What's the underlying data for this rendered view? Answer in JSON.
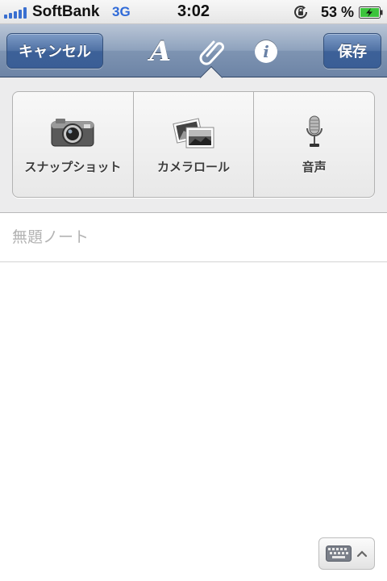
{
  "status_bar": {
    "carrier": "SoftBank",
    "network": "3G",
    "time": "3:02",
    "battery_percent": "53 %",
    "icons": [
      "signal-bars-icon",
      "rotation-lock-icon",
      "battery-charging-icon"
    ]
  },
  "nav": {
    "cancel_label": "キャンセル",
    "save_label": "保存",
    "format_icon_glyph": "A",
    "info_icon_glyph": "i",
    "icons": [
      "text-format-icon",
      "paperclip-icon",
      "info-icon"
    ]
  },
  "attach": {
    "items": [
      {
        "label": "スナップショット",
        "icon": "camera-icon"
      },
      {
        "label": "カメラロール",
        "icon": "photos-icon"
      },
      {
        "label": "音声",
        "icon": "microphone-icon"
      }
    ]
  },
  "note": {
    "title_placeholder": "無題ノート",
    "title_value": ""
  },
  "keyboard_toggle": {
    "icons": [
      "keyboard-icon",
      "chevron-up-icon"
    ]
  },
  "colors": {
    "nav_accent": "#4f71a4",
    "network_text": "#2f6ad8",
    "battery_fill": "#3cc43c"
  }
}
